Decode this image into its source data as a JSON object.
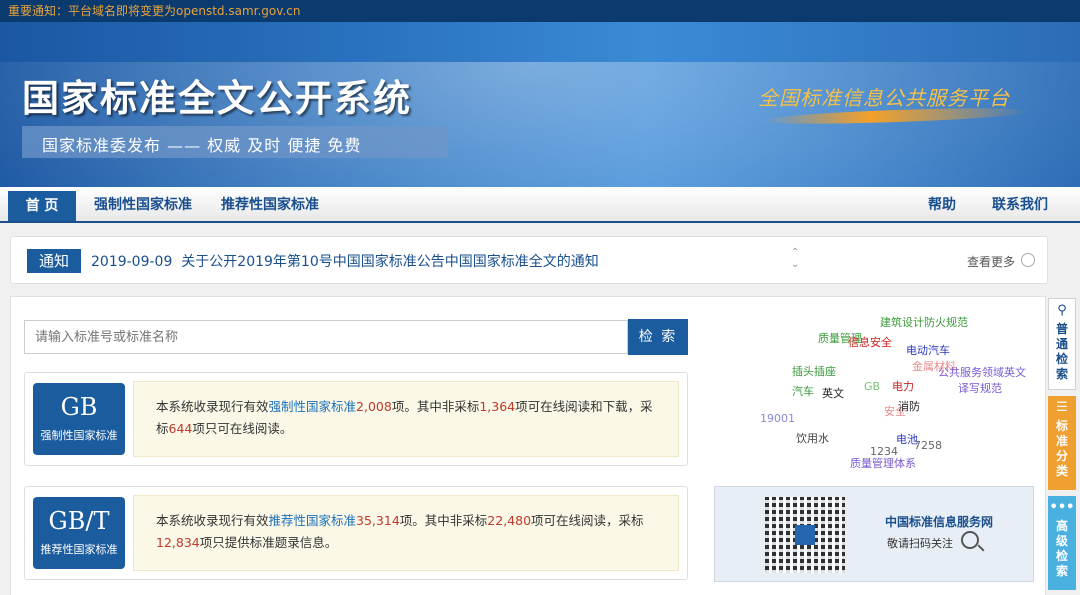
{
  "top_notice": "重要通知：平台域名即将变更为openstd.samr.gov.cn",
  "banner": {
    "title": "国家标准全文公开系统",
    "subtitle": "国家标准委发布 —— 权威 及时 便捷 免费",
    "right_slogan": "全国标准信息公共服务平台"
  },
  "nav": {
    "home": "首 页",
    "mandatory": "强制性国家标准",
    "recommended": "推荐性国家标准",
    "help": "帮助",
    "contact": "联系我们"
  },
  "notice": {
    "tag": "通知",
    "date": "2019-09-09",
    "text": "关于公开2019年第10号中国国家标准公告中国国家标准全文的通知",
    "more": "查看更多"
  },
  "search": {
    "placeholder": "请输入标准号或标准名称",
    "button": "检 索"
  },
  "cards": [
    {
      "badge": "GB",
      "badge_label": "强制性国家标准",
      "p1": "本系统收录现行有效",
      "link": "强制性国家标准",
      "n1": "2,008",
      "p2": "项。其中非采标",
      "n2": "1,364",
      "p3": "项可在线阅读和下载，采标",
      "n3": "644",
      "p4": "项只可在线阅读。"
    },
    {
      "badge": "GB/T",
      "badge_label": "推荐性国家标准",
      "p1": "本系统收录现行有效",
      "link": "推荐性国家标准",
      "n1": "35,314",
      "p2": "项。其中非采标",
      "n2": "22,480",
      "p3": "项可在线阅读，采标",
      "n3": "12,834",
      "p4": "项只提供标准题录信息。"
    }
  ],
  "tag_cloud": {
    "tags": [
      {
        "text": "建筑设计防火规范",
        "color": "#3a9a3a"
      },
      {
        "text": "质量管理",
        "color": "#3a9a3a"
      },
      {
        "text": "信息安全",
        "color": "#d02020"
      },
      {
        "text": "电动汽车",
        "color": "#2a3ac0"
      },
      {
        "text": "金属材料",
        "color": "#e88a8a"
      },
      {
        "text": "插头插座",
        "color": "#3a9a3a"
      },
      {
        "text": "公共服务领域英文",
        "color": "#7a5ad0"
      },
      {
        "text": "汽车",
        "color": "#3a9a3a"
      },
      {
        "text": "英文",
        "color": "#222222"
      },
      {
        "text": "GB",
        "color": "#7ac07a"
      },
      {
        "text": "电力",
        "color": "#d02020"
      },
      {
        "text": "译写规范",
        "color": "#7a5ad0"
      },
      {
        "text": "安全",
        "color": "#e88a8a"
      },
      {
        "text": "消防",
        "color": "#222222"
      },
      {
        "text": "19001",
        "color": "#8a8ad8"
      },
      {
        "text": "饮用水",
        "color": "#444444"
      },
      {
        "text": "电池",
        "color": "#2a3ac0"
      },
      {
        "text": "1234",
        "color": "#666666"
      },
      {
        "text": "7258",
        "color": "#666666"
      },
      {
        "text": "质量管理体系",
        "color": "#7a5ad0"
      }
    ]
  },
  "qr": {
    "title": "中国标准信息服务网",
    "subtitle": "敬请扫码关注"
  },
  "side_tabs": {
    "normal": "普通检索",
    "category": "标准分类",
    "advanced": "高级检索"
  }
}
